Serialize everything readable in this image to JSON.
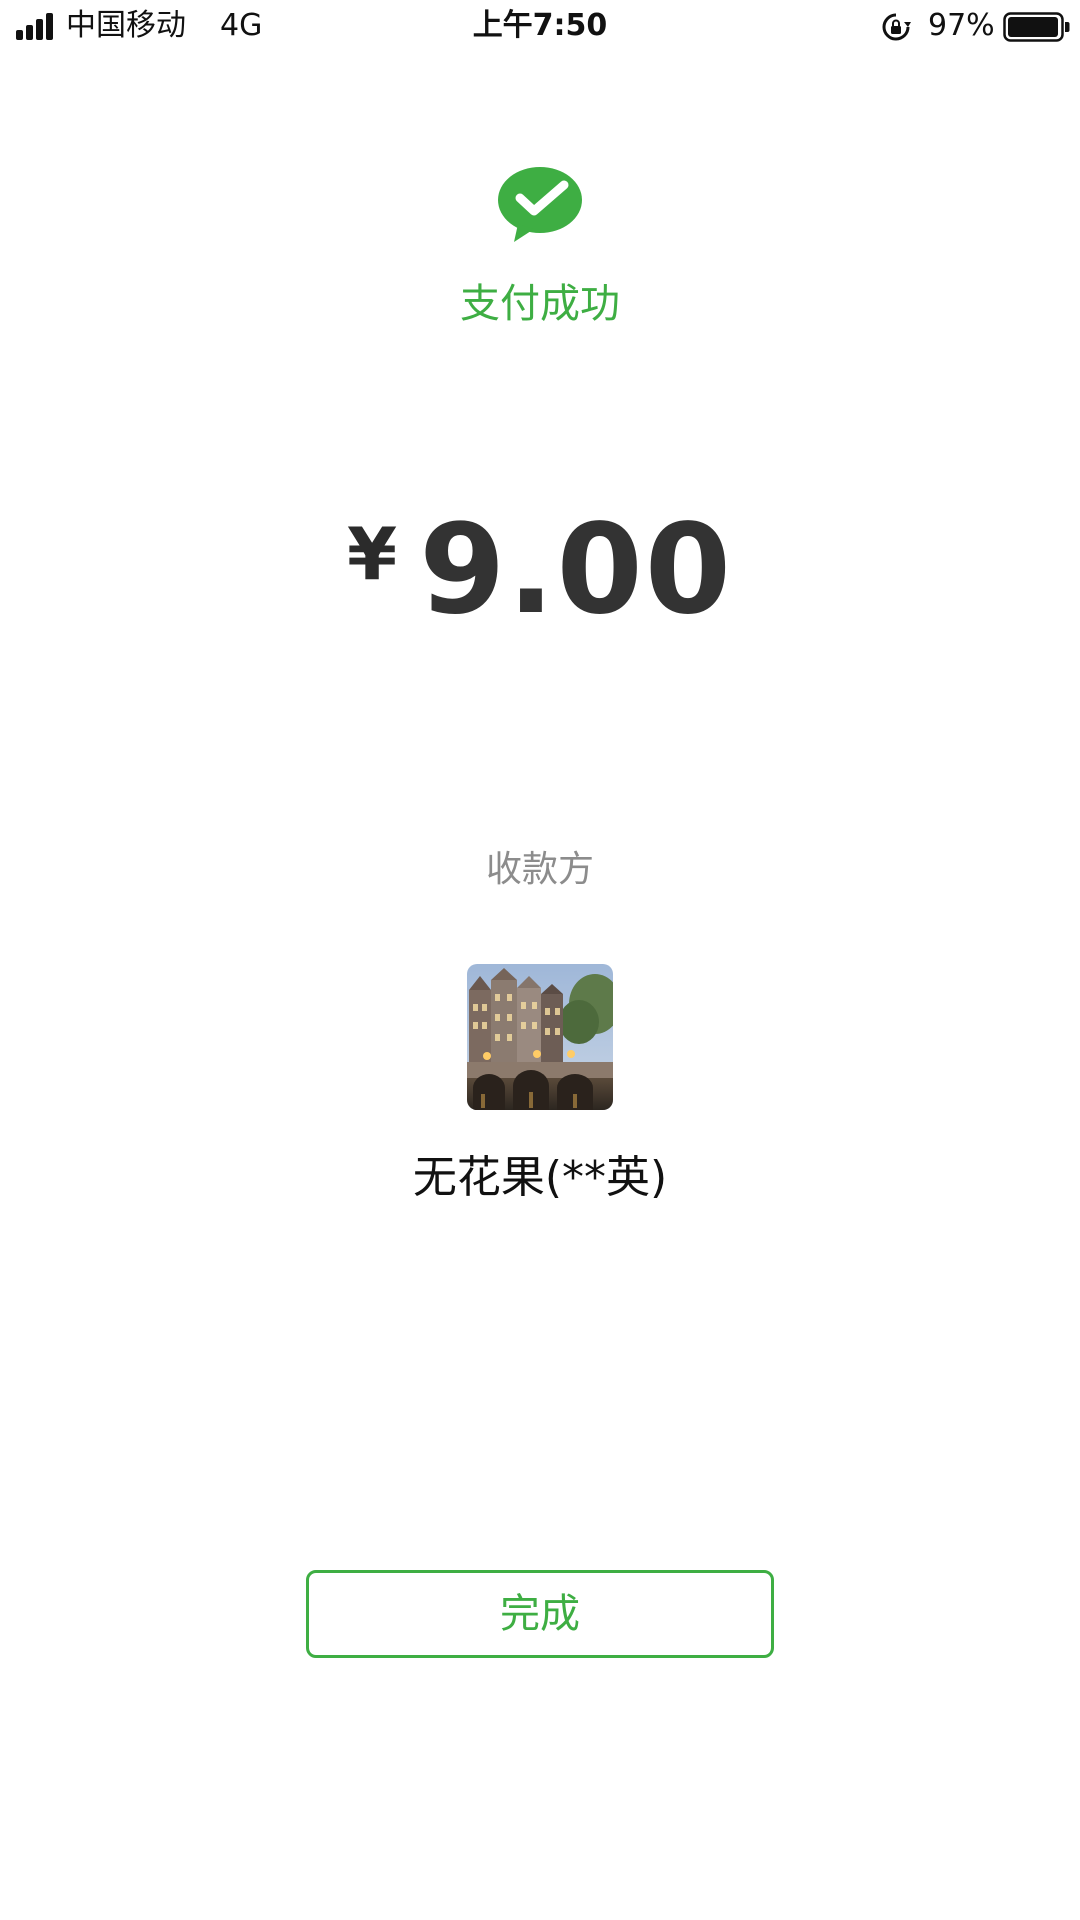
{
  "status_bar": {
    "carrier": "中国移动",
    "network": "4G",
    "time": "上午7:50",
    "battery_percent": "97%",
    "signal_icon": "signal-bars-icon",
    "lock_icon": "rotation-lock-icon",
    "battery_icon": "battery-icon"
  },
  "payment": {
    "status_icon": "wechat-pay-success-icon",
    "status_text": "支付成功",
    "currency_symbol": "¥",
    "amount": "9.00"
  },
  "payee": {
    "label": "收款方",
    "avatar": "payee-avatar-canal-photo",
    "name": "无花果(**英)"
  },
  "actions": {
    "done_label": "完成"
  },
  "colors": {
    "accent_green": "#3eae43",
    "amount_text": "#333333",
    "muted_text": "#8c8c8c"
  }
}
